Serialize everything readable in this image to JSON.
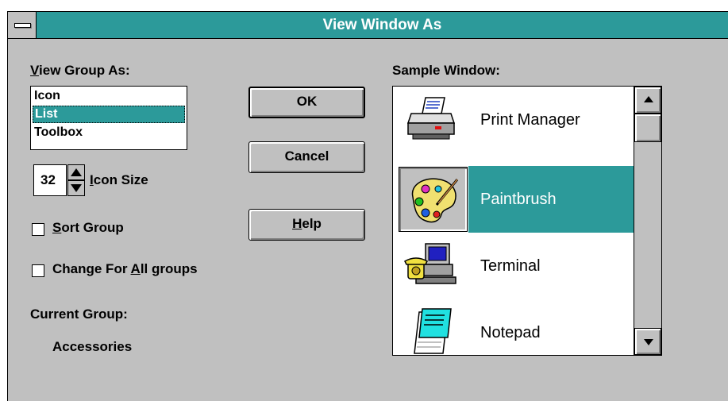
{
  "window": {
    "title": "View Window As"
  },
  "view_group": {
    "label_hotkey": "V",
    "label_rest": "iew Group As:",
    "items": [
      {
        "label": "Icon",
        "selected": false
      },
      {
        "label": "List",
        "selected": true
      },
      {
        "label": "Toolbox",
        "selected": false
      }
    ]
  },
  "icon_size": {
    "value": "32",
    "label_hotkey": "I",
    "label_rest": "con Size"
  },
  "sort_group": {
    "label_hotkey": "S",
    "label_rest": "ort Group",
    "checked": false
  },
  "change_all": {
    "label_pre": "Change For ",
    "label_hotkey": "A",
    "label_rest": "ll groups",
    "checked": false
  },
  "current_group": {
    "label": "Current Group:",
    "value": "Accessories"
  },
  "buttons": {
    "ok": "OK",
    "cancel": "Cancel",
    "help_hotkey": "H",
    "help_rest": "elp"
  },
  "sample": {
    "label": "Sample Window:",
    "items": [
      {
        "name": "Print Manager",
        "icon": "printer-icon",
        "selected": false
      },
      {
        "name": "Paintbrush",
        "icon": "palette-icon",
        "selected": true
      },
      {
        "name": "Terminal",
        "icon": "terminal-computer-icon",
        "selected": false
      },
      {
        "name": "Notepad",
        "icon": "notepad-icon",
        "selected": false
      }
    ]
  },
  "colors": {
    "accent": "#2c9a9a",
    "face": "#c0c0c0"
  }
}
